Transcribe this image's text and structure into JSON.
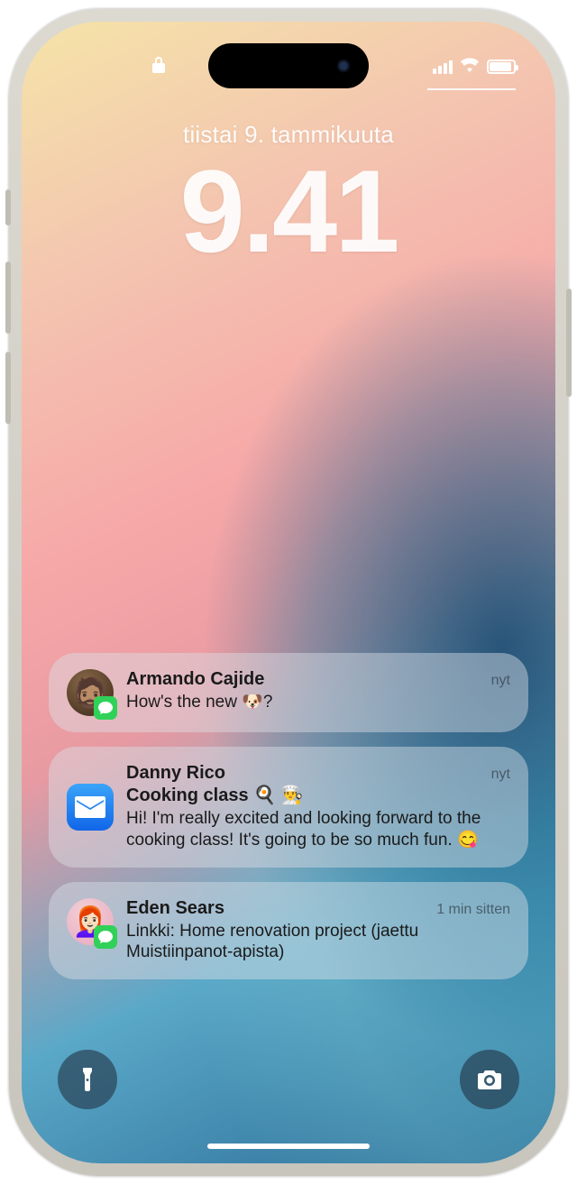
{
  "status": {
    "lock_icon": "lock",
    "signal": 4,
    "wifi": true,
    "battery_pct": 90
  },
  "datetime": {
    "date": "tiistai 9. tammikuuta",
    "time": "9.41"
  },
  "notifications": [
    {
      "app": "messages",
      "sender": "Armando Cajide",
      "time": "nyt",
      "message": "How's the new 🐶?"
    },
    {
      "app": "mail",
      "sender": "Danny Rico",
      "subject": "Cooking class 🍳 👨‍🍳",
      "time": "nyt",
      "message": "Hi! I'm really excited and looking forward to the cooking class! It's going to be so much fun. 😋"
    },
    {
      "app": "messages",
      "sender": "Eden Sears",
      "time": "1 min sitten",
      "message": "Linkki: Home renovation project (jaettu Muistiinpanot-apista)"
    }
  ],
  "actions": {
    "flashlight": "flashlight",
    "camera": "camera"
  }
}
